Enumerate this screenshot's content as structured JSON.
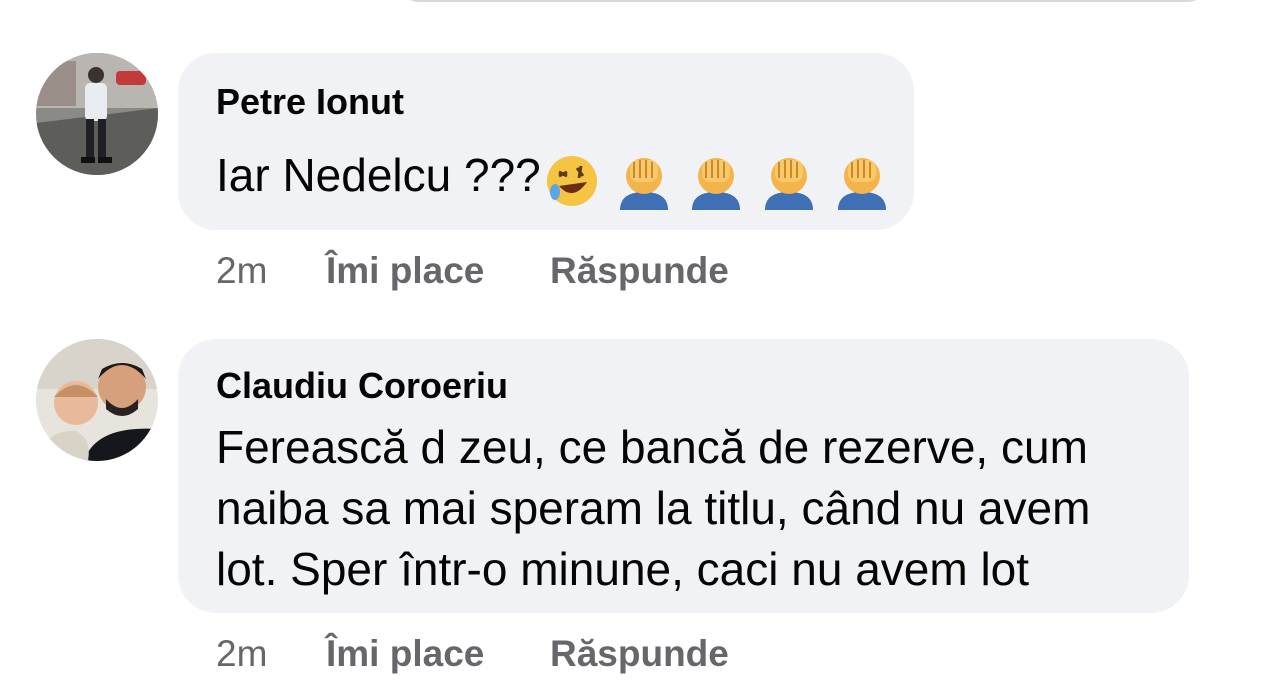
{
  "comments": [
    {
      "author": "Petre Ionut",
      "text": "Iar Nedelcu ???",
      "emojis": [
        "rolling-on-floor-laughing-emoji",
        "facepalm-emoji",
        "facepalm-emoji",
        "facepalm-emoji",
        "facepalm-emoji"
      ],
      "time": "2m",
      "like_label": "Îmi place",
      "reply_label": "Răspunde"
    },
    {
      "author": "Claudiu Coroeriu",
      "text_lines": [
        "Ferească d zeu, ce bancă de rezerve, cum",
        "naiba sa mai speram la titlu, când nu avem",
        "lot. Sper într-o minune, caci nu avem lot"
      ],
      "time": "2m",
      "like_label": "Îmi place",
      "reply_label": "Răspunde"
    }
  ]
}
